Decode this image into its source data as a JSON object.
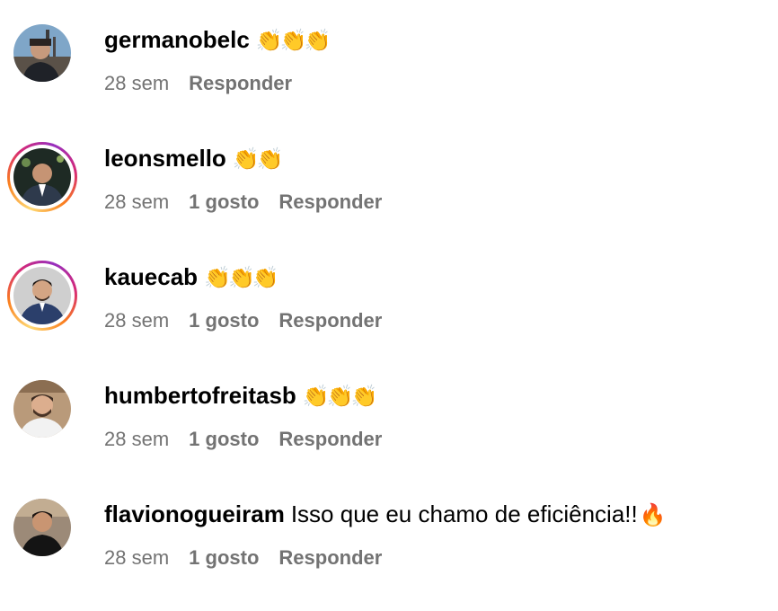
{
  "comments": [
    {
      "username": "germanobelc",
      "text": "",
      "emoji": "👏👏👏",
      "time": "28 sem",
      "likes": "",
      "reply_label": "Responder",
      "story_ring": false,
      "avatar_icon": "avatar-photo-icon"
    },
    {
      "username": "leonsmello",
      "text": "",
      "emoji": "👏👏",
      "time": "28 sem",
      "likes": "1 gosto",
      "reply_label": "Responder",
      "story_ring": true,
      "avatar_icon": "avatar-photo-icon"
    },
    {
      "username": "kauecab",
      "text": "",
      "emoji": "👏👏👏",
      "time": "28 sem",
      "likes": "1 gosto",
      "reply_label": "Responder",
      "story_ring": true,
      "avatar_icon": "avatar-photo-icon"
    },
    {
      "username": "humbertofreitasb",
      "text": "",
      "emoji": "👏👏👏",
      "time": "28 sem",
      "likes": "1 gosto",
      "reply_label": "Responder",
      "story_ring": false,
      "avatar_icon": "avatar-photo-icon"
    },
    {
      "username": "flavionogueiram",
      "text": "Isso que eu chamo de eficiência!!",
      "emoji": "🔥",
      "time": "28 sem",
      "likes": "1 gosto",
      "reply_label": "Responder",
      "story_ring": false,
      "avatar_icon": "avatar-photo-icon"
    }
  ],
  "colors": {
    "meta_text": "#737373",
    "story_ring": [
      "#feda75",
      "#fa7e1e",
      "#d62976",
      "#962fbf"
    ]
  }
}
